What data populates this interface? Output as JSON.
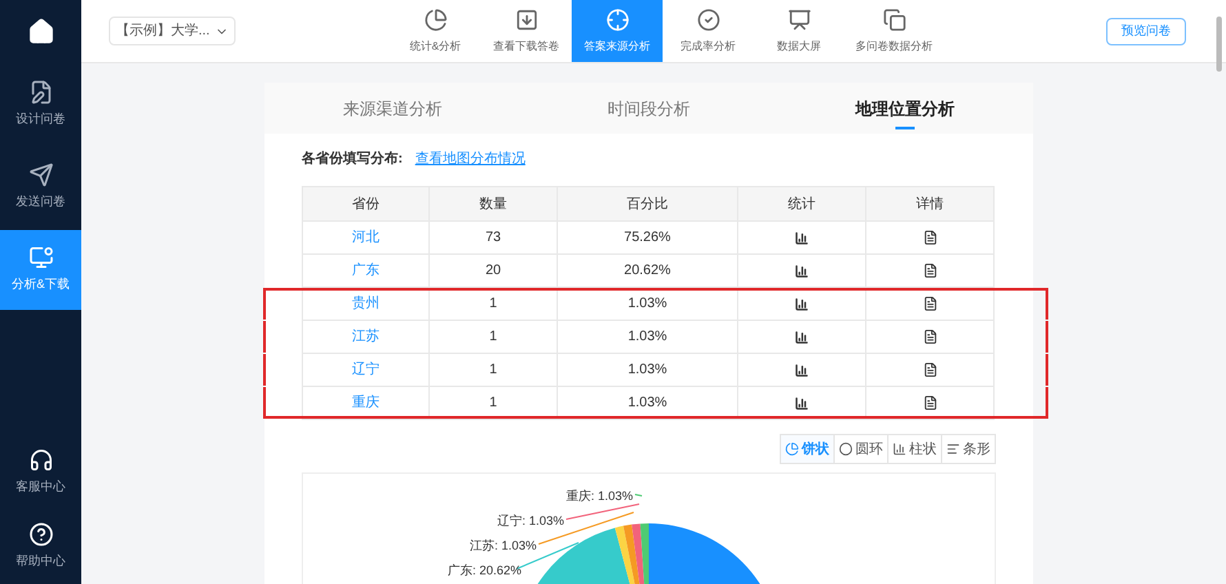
{
  "sidebar": {
    "items": [
      {
        "label": "设计问卷",
        "selected": false
      },
      {
        "label": "发送问卷",
        "selected": false
      },
      {
        "label": "分析&下载",
        "selected": true
      }
    ],
    "bottom_items": [
      {
        "label": "客服中心"
      },
      {
        "label": "帮助中心"
      }
    ]
  },
  "survey_select": {
    "value": "【示例】大学..."
  },
  "nav": [
    {
      "label": "统计&分析",
      "selected": false
    },
    {
      "label": "查看下载答卷",
      "selected": false
    },
    {
      "label": "答案来源分析",
      "selected": true
    },
    {
      "label": "完成率分析",
      "selected": false
    },
    {
      "label": "数据大屏",
      "selected": false
    },
    {
      "label": "多问卷数据分析",
      "selected": false
    }
  ],
  "preview_button": "预览问卷",
  "tabs": [
    {
      "label": "来源渠道分析",
      "selected": false
    },
    {
      "label": "时间段分析",
      "selected": false
    },
    {
      "label": "地理位置分析",
      "selected": true
    }
  ],
  "section": {
    "title": "各省份填写分布:",
    "link": "查看地图分布情况"
  },
  "table": {
    "columns": [
      "省份",
      "数量",
      "百分比",
      "统计",
      "详情"
    ],
    "rows": [
      {
        "province": "河北",
        "count": "73",
        "percent": "75.26%",
        "highlighted": false
      },
      {
        "province": "广东",
        "count": "20",
        "percent": "20.62%",
        "highlighted": false
      },
      {
        "province": "贵州",
        "count": "1",
        "percent": "1.03%",
        "highlighted": true
      },
      {
        "province": "江苏",
        "count": "1",
        "percent": "1.03%",
        "highlighted": true
      },
      {
        "province": "辽宁",
        "count": "1",
        "percent": "1.03%",
        "highlighted": true
      },
      {
        "province": "重庆",
        "count": "1",
        "percent": "1.03%",
        "highlighted": true
      }
    ]
  },
  "chart_types": [
    {
      "label": "饼状",
      "selected": true
    },
    {
      "label": "圆环",
      "selected": false
    },
    {
      "label": "柱状",
      "selected": false
    },
    {
      "label": "条形",
      "selected": false
    }
  ],
  "chart": {
    "labels": [
      {
        "text": "重庆: 1.03%",
        "color": "#4ecb73"
      },
      {
        "text": "辽宁: 1.03%",
        "color": "#f2637b"
      },
      {
        "text": "江苏: 1.03%",
        "color": "#f59a23"
      },
      {
        "text": "广东: 20.62%",
        "color": "#36cbcb"
      }
    ]
  }
}
